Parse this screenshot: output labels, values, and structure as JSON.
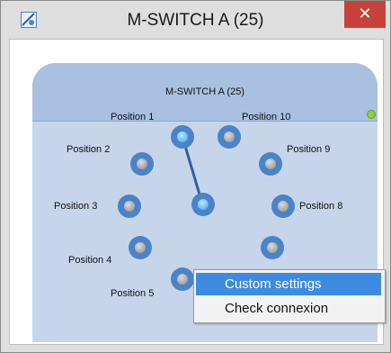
{
  "window": {
    "title": "M-SWITCH A (25)",
    "close_glyph": "✕"
  },
  "panel": {
    "title": "M-SWITCH A (25)",
    "status_color": "#8fcf3a"
  },
  "positions": [
    {
      "label": "Position 1",
      "active": true
    },
    {
      "label": "Position 2",
      "active": false
    },
    {
      "label": "Position 3",
      "active": false
    },
    {
      "label": "Position 4",
      "active": false
    },
    {
      "label": "Position 5",
      "active": false
    },
    {
      "label": "Position 8",
      "active": false
    },
    {
      "label": "Position 9",
      "active": false
    },
    {
      "label": "Position 10",
      "active": false
    }
  ],
  "context_menu": {
    "items": [
      {
        "label": "Custom settings",
        "selected": true
      },
      {
        "label": "Check connexion",
        "selected": false
      }
    ]
  },
  "colors": {
    "accent": "#3d8be0",
    "close": "#c7413a",
    "knob": "#4a83c7"
  },
  "icons": {
    "app": "switch-app-icon",
    "close": "close-icon"
  }
}
